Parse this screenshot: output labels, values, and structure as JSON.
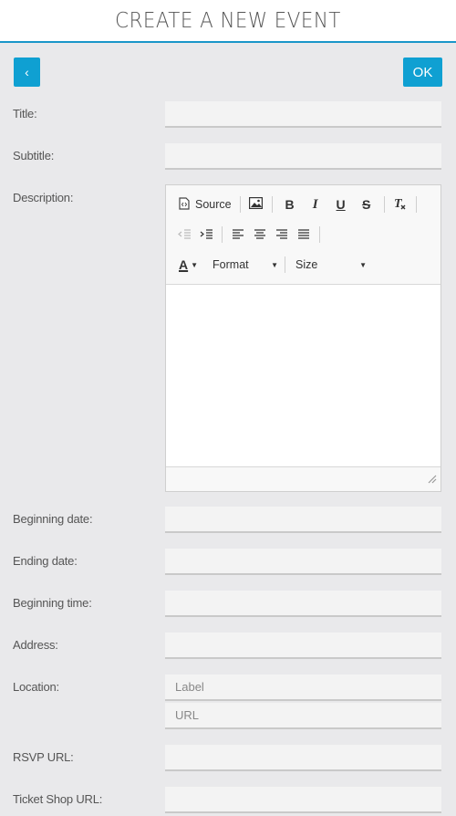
{
  "header": {
    "title": "CREATE A NEW EVENT"
  },
  "actions": {
    "back_label": "‹",
    "ok_label": "OK"
  },
  "form": {
    "title_label": "Title:",
    "subtitle_label": "Subtitle:",
    "description_label": "Description:",
    "beginning_date_label": "Beginning date:",
    "ending_date_label": "Ending date:",
    "beginning_time_label": "Beginning time:",
    "address_label": "Address:",
    "location_label": "Location:",
    "location_label_placeholder": "Label",
    "location_url_placeholder": "URL",
    "rsvp_label": "RSVP URL:",
    "ticket_label": "Ticket Shop URL:"
  },
  "editor": {
    "source_label": "Source",
    "bold": "B",
    "italic": "I",
    "underline": "U",
    "strike": "S",
    "format_label": "Format",
    "size_label": "Size",
    "text_color_glyph": "A"
  },
  "colors": {
    "accent": "#0fa0d2",
    "header_line": "#1a96c9",
    "background": "#e9e9eb"
  }
}
